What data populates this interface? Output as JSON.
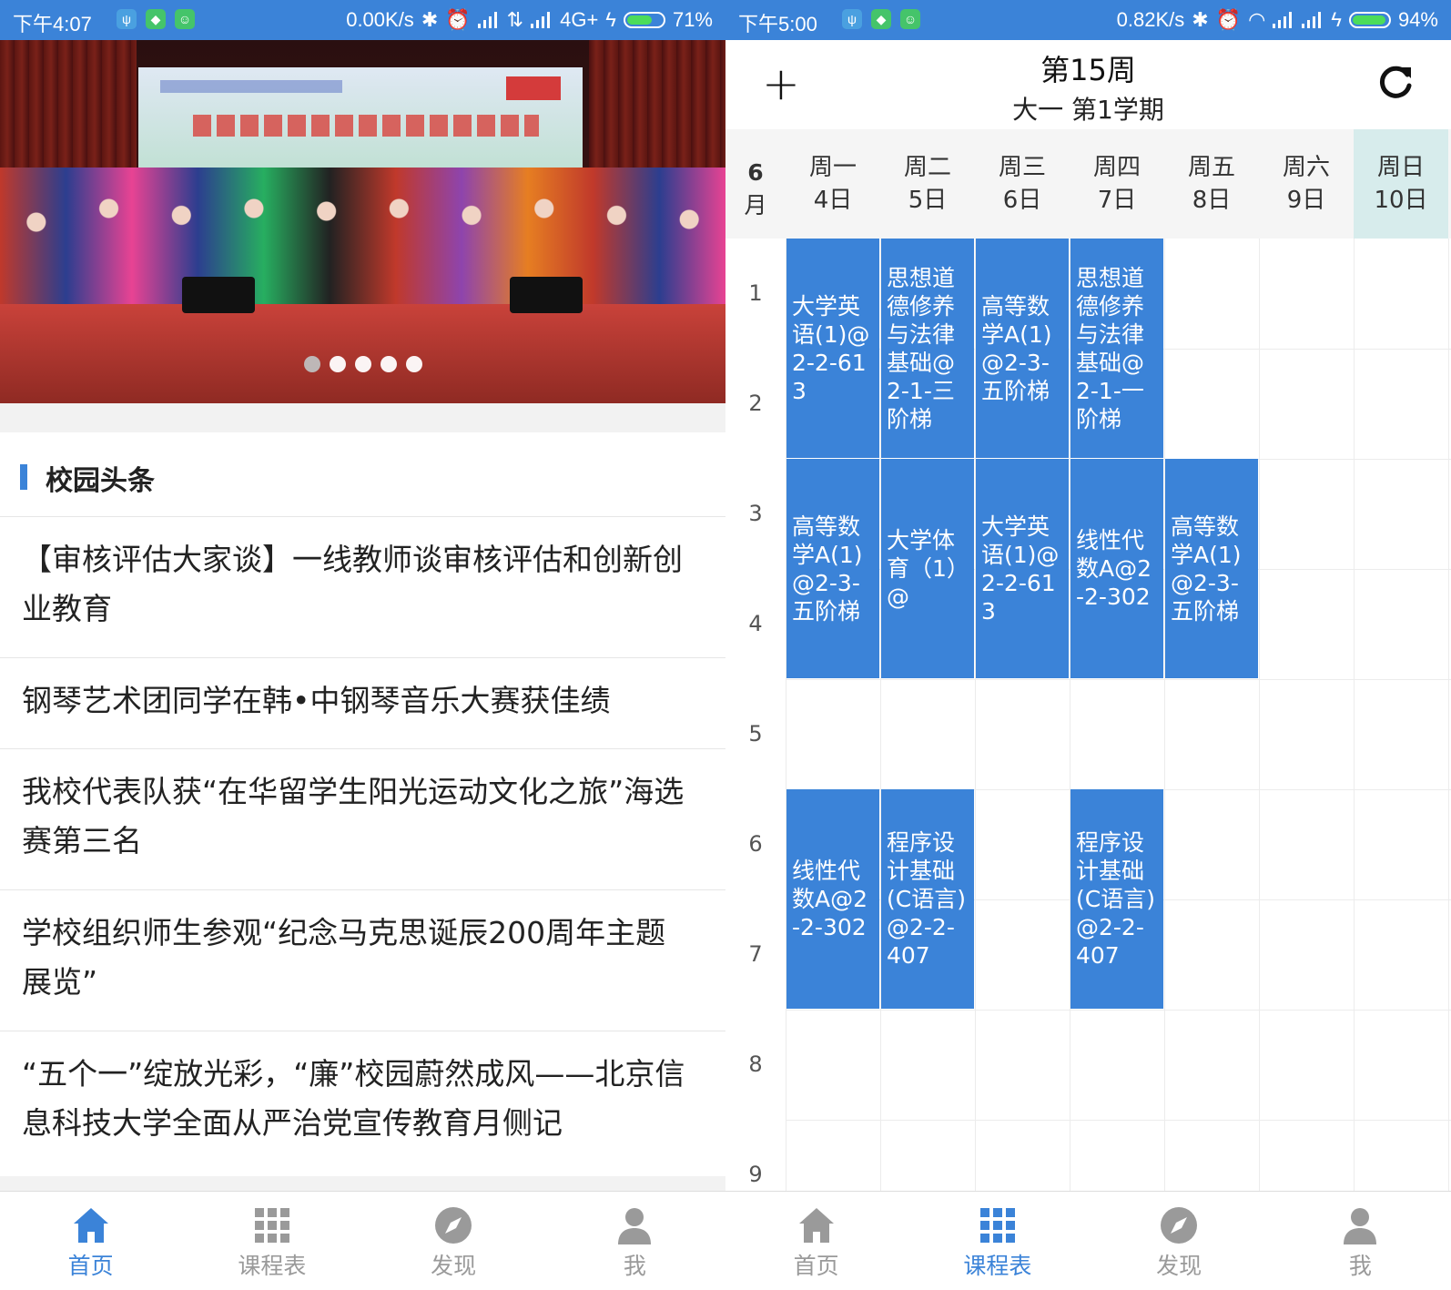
{
  "left_phone": {
    "status": {
      "time": "下午4:07",
      "speed": "0.00K/s",
      "network": "4G+",
      "battery": "71%",
      "battery_level": 0.71
    },
    "banner": {
      "slide_count": 5,
      "active_index": 0
    },
    "section_title": "校园头条",
    "news": [
      {
        "title": "【审核评估大家谈】一线教师谈审核评估和创新创业教育"
      },
      {
        "title": "钢琴艺术团同学在韩•中钢琴音乐大赛获佳绩"
      },
      {
        "title": "我校代表队获“在华留学生阳光运动文化之旅”海选赛第三名"
      },
      {
        "title": "学校组织师生参观“纪念马克思诞辰200周年主题展览”"
      },
      {
        "title": "“五个一”绽放光彩，“廉”校园蔚然成风——北京信息科技大学全面从严治党宣传教育月侧记"
      }
    ]
  },
  "right_phone": {
    "status": {
      "time": "下午5:00",
      "speed": "0.82K/s",
      "battery": "94%",
      "battery_level": 0.94
    },
    "header": {
      "week": "第15周",
      "semester": "大一 第1学期"
    },
    "month": {
      "num": "6",
      "unit": "月"
    },
    "days": [
      {
        "name": "周一",
        "date": "4日"
      },
      {
        "name": "周二",
        "date": "5日"
      },
      {
        "name": "周三",
        "date": "6日"
      },
      {
        "name": "周四",
        "date": "7日"
      },
      {
        "name": "周五",
        "date": "8日"
      },
      {
        "name": "周六",
        "date": "9日"
      },
      {
        "name": "周日",
        "date": "10日",
        "today": true
      }
    ],
    "periods": [
      "1",
      "2",
      "3",
      "4",
      "5",
      "6",
      "7",
      "8",
      "9"
    ],
    "courses": [
      {
        "day": 1,
        "start": 1,
        "span": 2,
        "text": "大学英语(1)@2-2-613"
      },
      {
        "day": 2,
        "start": 1,
        "span": 2,
        "text": "思想道德修养与法律基础@2-1-三阶梯"
      },
      {
        "day": 3,
        "start": 1,
        "span": 2,
        "text": "高等数学A(1)@2-3-五阶梯"
      },
      {
        "day": 4,
        "start": 1,
        "span": 2,
        "text": "思想道德修养与法律基础@2-1-一阶梯"
      },
      {
        "day": 1,
        "start": 3,
        "span": 2,
        "text": "高等数学A(1)@2-3-五阶梯"
      },
      {
        "day": 2,
        "start": 3,
        "span": 2,
        "text": "大学体育（1）@"
      },
      {
        "day": 3,
        "start": 3,
        "span": 2,
        "text": "大学英语(1)@2-2-613"
      },
      {
        "day": 4,
        "start": 3,
        "span": 2,
        "text": "线性代数A@2-2-302"
      },
      {
        "day": 5,
        "start": 3,
        "span": 2,
        "text": "高等数学A(1)@2-3-五阶梯"
      },
      {
        "day": 1,
        "start": 6,
        "span": 2,
        "text": "线性代数A@2-2-302"
      },
      {
        "day": 2,
        "start": 6,
        "span": 2,
        "text": "程序设计基础(C语言)@2-2-407"
      },
      {
        "day": 4,
        "start": 6,
        "span": 2,
        "text": "程序设计基础(C语言)@2-2-407"
      }
    ]
  },
  "tabs": [
    {
      "label": "首页",
      "icon": "home-icon"
    },
    {
      "label": "课程表",
      "icon": "grid-icon"
    },
    {
      "label": "发现",
      "icon": "compass-icon"
    },
    {
      "label": "我",
      "icon": "user-icon"
    }
  ],
  "left_active_tab": 0,
  "right_active_tab": 1,
  "colors": {
    "accent": "#3b83d8",
    "today_bg": "#d7ecec",
    "tab_inactive": "#9a9a9a"
  }
}
